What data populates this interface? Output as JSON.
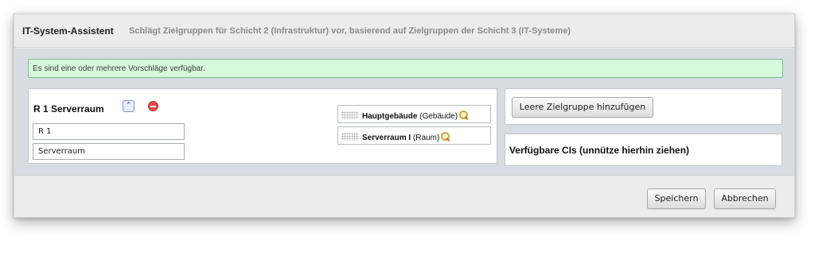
{
  "dialog": {
    "title": "IT-System-Assistent",
    "subtitle": "Schlägt Zielgruppen für Schicht 2 (Infrastruktur) vor, basierend auf Zielgruppen der Schicht 3 (IT-Systeme)"
  },
  "message": {
    "text": "Es sind eine oder mehrere Vorschläge verfügbar.",
    "background": "#d7f9dd",
    "border": "#7fbd8c"
  },
  "group": {
    "title": "R 1 Serverraum",
    "collapse_icon": "double-chevron-up-icon",
    "remove_icon": "minus-circle-icon",
    "fields": {
      "short_name": "R 1",
      "name": "Serverraum"
    },
    "cis": [
      {
        "name": "Hauptgebäude",
        "type": "(Gebäude)",
        "icon": "magnifier-icon"
      },
      {
        "name": "Serverraum I",
        "type": "(Raum)",
        "icon": "magnifier-icon"
      }
    ]
  },
  "right_panel": {
    "add_button_label": "Leere Zielgruppe hinzufügen",
    "available_label": "Verfügbare CIs (unnütze hierhin ziehen)"
  },
  "footer": {
    "save_label": "Speichern",
    "cancel_label": "Abbrechen"
  }
}
